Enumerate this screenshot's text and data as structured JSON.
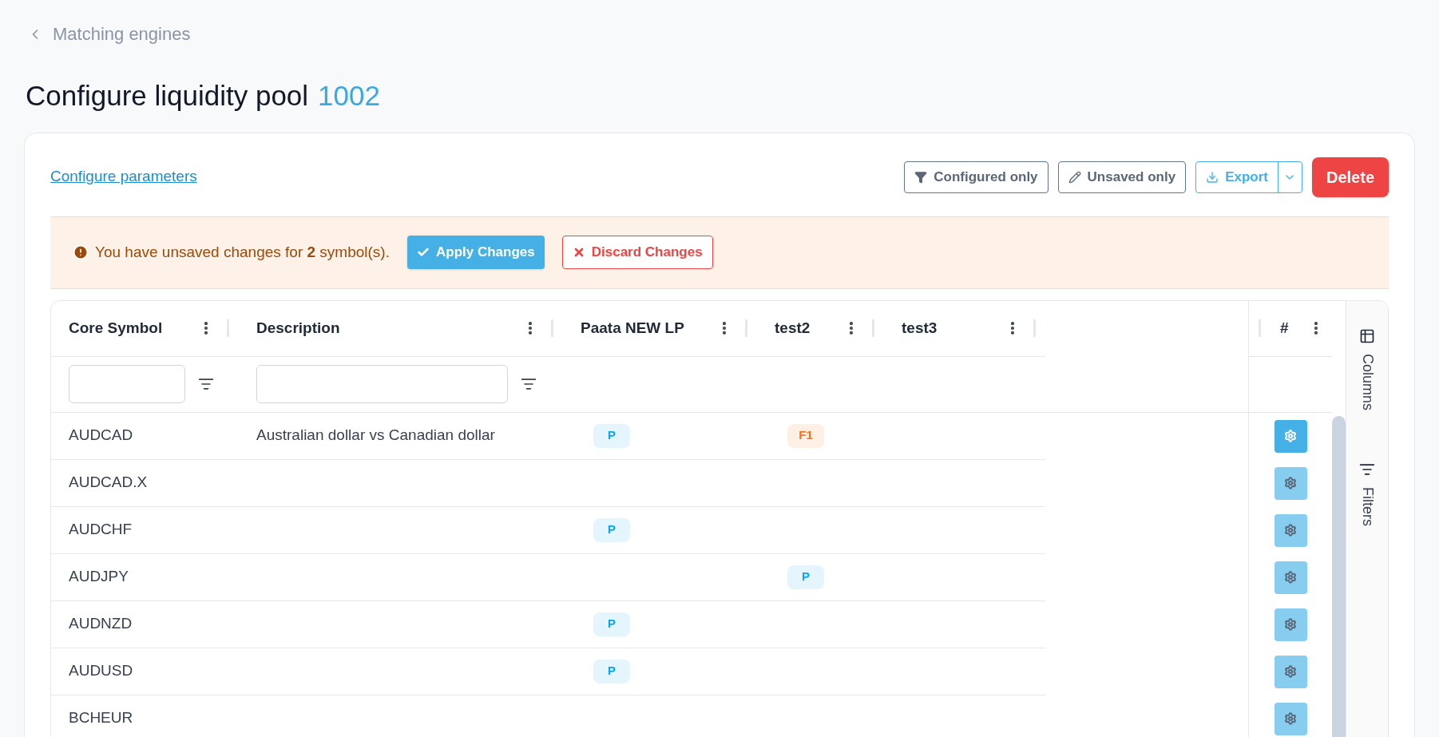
{
  "breadcrumb": {
    "label": "Matching engines"
  },
  "title": {
    "text": "Configure liquidity pool",
    "id": "1002"
  },
  "toolbar": {
    "link": "Configure parameters",
    "configured_only": "Configured only",
    "unsaved_only": "Unsaved only",
    "export": "Export",
    "delete": "Delete"
  },
  "alert": {
    "message": "You have unsaved changes for **2** symbol(s).",
    "apply": "Apply Changes",
    "discard": "Discard Changes"
  },
  "table": {
    "columns": [
      {
        "label": "Core Symbol",
        "filterable": true
      },
      {
        "label": "Description",
        "filterable": true
      },
      {
        "label": "Paata NEW LP",
        "filterable": false
      },
      {
        "label": "test2",
        "filterable": false
      },
      {
        "label": "test3",
        "filterable": false
      }
    ],
    "action_column": "#",
    "rows": [
      {
        "symbol": "AUDCAD",
        "description": "Australian dollar vs Canadian dollar",
        "selected": true,
        "cells": [
          {
            "badge": {
              "text": "P",
              "color": "#0ea5e9"
            }
          },
          {
            "badge": {
              "text": "F1",
              "color": "#f97316"
            }
          },
          {}
        ]
      },
      {
        "symbol": "AUDCAD.X",
        "selected": false,
        "cells": [
          {},
          {},
          {}
        ]
      },
      {
        "symbol": "AUDCHF",
        "selected": false,
        "cells": [
          {
            "badge": {
              "text": "P",
              "color": "#0ea5e9"
            }
          },
          {},
          {}
        ]
      },
      {
        "symbol": "AUDJPY",
        "selected": false,
        "cells": [
          {},
          {
            "badge": {
              "text": "P",
              "color": "#0ea5e9"
            }
          },
          {}
        ]
      },
      {
        "symbol": "AUDNZD",
        "selected": false,
        "cells": [
          {
            "badge": {
              "text": "P",
              "color": "#0ea5e9"
            }
          },
          {},
          {}
        ]
      },
      {
        "symbol": "AUDUSD",
        "selected": false,
        "cells": [
          {
            "badge": {
              "text": "P",
              "color": "#0ea5e9"
            }
          },
          {},
          {}
        ]
      },
      {
        "symbol": "BCHEUR",
        "selected": false,
        "cells": [
          {},
          {},
          {}
        ]
      }
    ]
  },
  "side_panel": [
    {
      "kind": "columns",
      "label": "Columns"
    },
    {
      "kind": "filters",
      "label": "Filters"
    }
  ]
}
